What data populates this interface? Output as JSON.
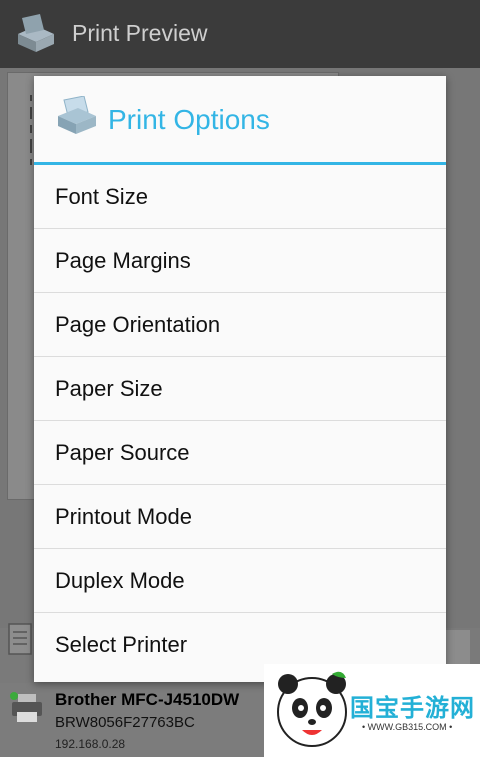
{
  "appbar": {
    "title": "Print Preview"
  },
  "dialog": {
    "title": "Print Options",
    "items": [
      {
        "label": "Font Size"
      },
      {
        "label": "Page Margins"
      },
      {
        "label": "Page Orientation"
      },
      {
        "label": "Paper Size"
      },
      {
        "label": "Paper Source"
      },
      {
        "label": "Printout Mode"
      },
      {
        "label": "Duplex Mode"
      },
      {
        "label": "Select Printer"
      }
    ]
  },
  "printer": {
    "name": "Brother MFC-J4510DW",
    "id": "BRW8056F27763BC",
    "ip": "192.168.0.28"
  },
  "watermark": {
    "brand": "国宝手游网",
    "url": "• WWW.GB315.COM •"
  },
  "colors": {
    "accent": "#33b5e5",
    "appbar": "#3b3b3b"
  }
}
